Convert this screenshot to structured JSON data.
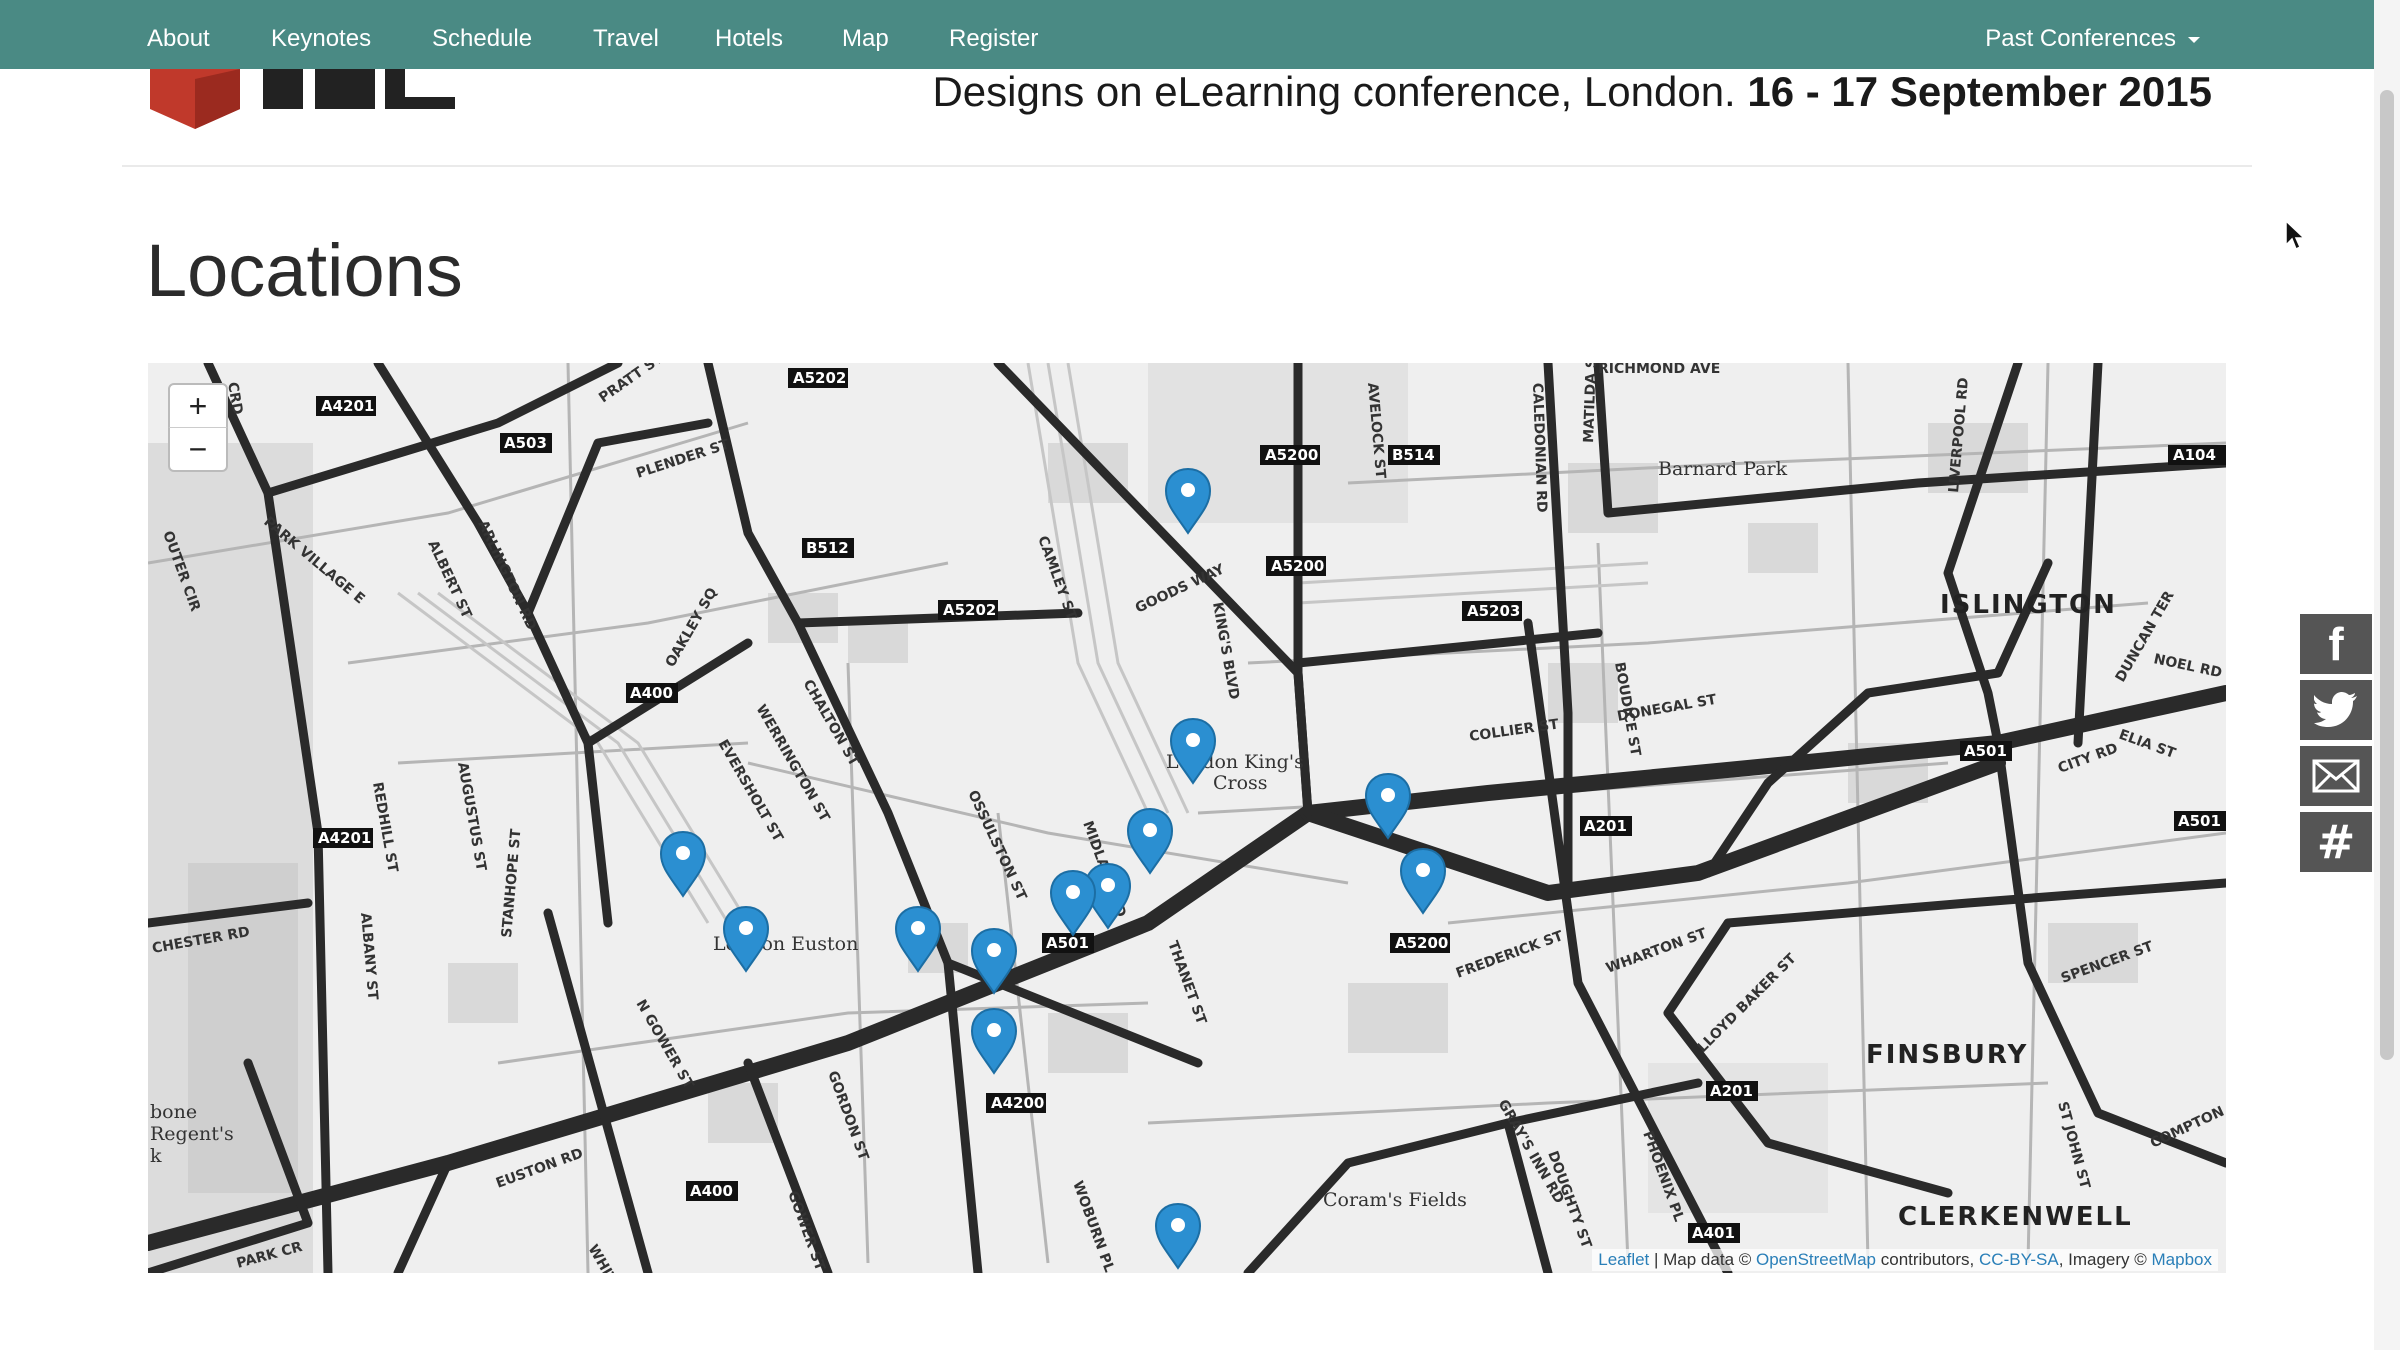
{
  "nav": {
    "items": [
      {
        "label": "About"
      },
      {
        "label": "Keynotes"
      },
      {
        "label": "Schedule"
      },
      {
        "label": "Travel"
      },
      {
        "label": "Hotels"
      },
      {
        "label": "Map"
      },
      {
        "label": "Register"
      }
    ],
    "past_conferences": "Past Conferences"
  },
  "banner": {
    "text": "Designs on eLearning conference, London. ",
    "dates": "16 - 17 September 2015"
  },
  "page_title": "Locations",
  "map": {
    "zoom_in": "+",
    "zoom_out": "−",
    "attribution": {
      "leaflet": "Leaflet",
      "map_data": " | Map data © ",
      "osm": "OpenStreetMap",
      "contributors": " contributors, ",
      "license": "CC-BY-SA",
      "imagery": ", Imagery © ",
      "mapbox": "Mapbox"
    },
    "area_labels": [
      "ISLINGTON",
      "FINSBURY",
      "CLERKENWELL"
    ],
    "place_labels": [
      "London King's",
      "Cross",
      "London Euston",
      "Coram's Fields",
      "Barnard Park",
      "bone",
      "Regent's",
      "k"
    ],
    "street_labels": [
      "PRATT ST",
      "PLENDER ST",
      "ARLINGTON RD",
      "PARK VILLAGE E",
      "ALBERT ST",
      "OUTER CIR",
      "OAKLEY SQ",
      "CHALTON ST",
      "WERRINGTON ST",
      "EVERSHOLT ST",
      "OSSULSTON ST",
      "MIDLAND RD",
      "CAMLEY ST",
      "GOODS WAY",
      "KING'S BLVD",
      "COLLIER ST",
      "DONEGAL ST",
      "RICHMOND AVE",
      "NOEL RD",
      "CITY RD",
      "ELIA ST",
      "WHARTON ST",
      "LLOYD BAKER ST",
      "SPENCER ST",
      "FREDERICK ST",
      "GRAY'S INN RD",
      "EUSTON RD",
      "GORDON ST",
      "GOWER ST",
      "THANET ST",
      "WOBURN PL",
      "ALBANY ST",
      "STANHOPE ST",
      "AUGUSTUS ST",
      "REDHILL ST",
      "CHESTER RD",
      "PARK CR",
      "WHITFIELD",
      "N GOWER ST",
      "DOUGHTY ST",
      "PHOENIX PL",
      "ST JOHN ST",
      "COMPTON",
      "BOUDICE ST",
      "DUNCAN TER",
      "LIVERPOOL RD",
      "MATILDA ST",
      "CALEDONIAN RD",
      "AVELOCK ST",
      "CRD"
    ],
    "road_badges": [
      "A4201",
      "A503",
      "A5202",
      "B512",
      "A5202",
      "A400",
      "A4201",
      "A5200",
      "B514",
      "A5200",
      "A5203",
      "A104",
      "A501",
      "A501",
      "A201",
      "A501",
      "A5200",
      "A4200",
      "A400",
      "A201",
      "A401"
    ],
    "marker_count": 15,
    "marker_color": "#2b8fd1"
  },
  "share": {
    "facebook": "f",
    "twitter_icon": "twitter-bird",
    "email_icon": "envelope",
    "hashtag": "#"
  },
  "colors": {
    "nav_bg": "#4a8a84",
    "logo_red": "#c0392b",
    "share_bg": "#555555"
  }
}
